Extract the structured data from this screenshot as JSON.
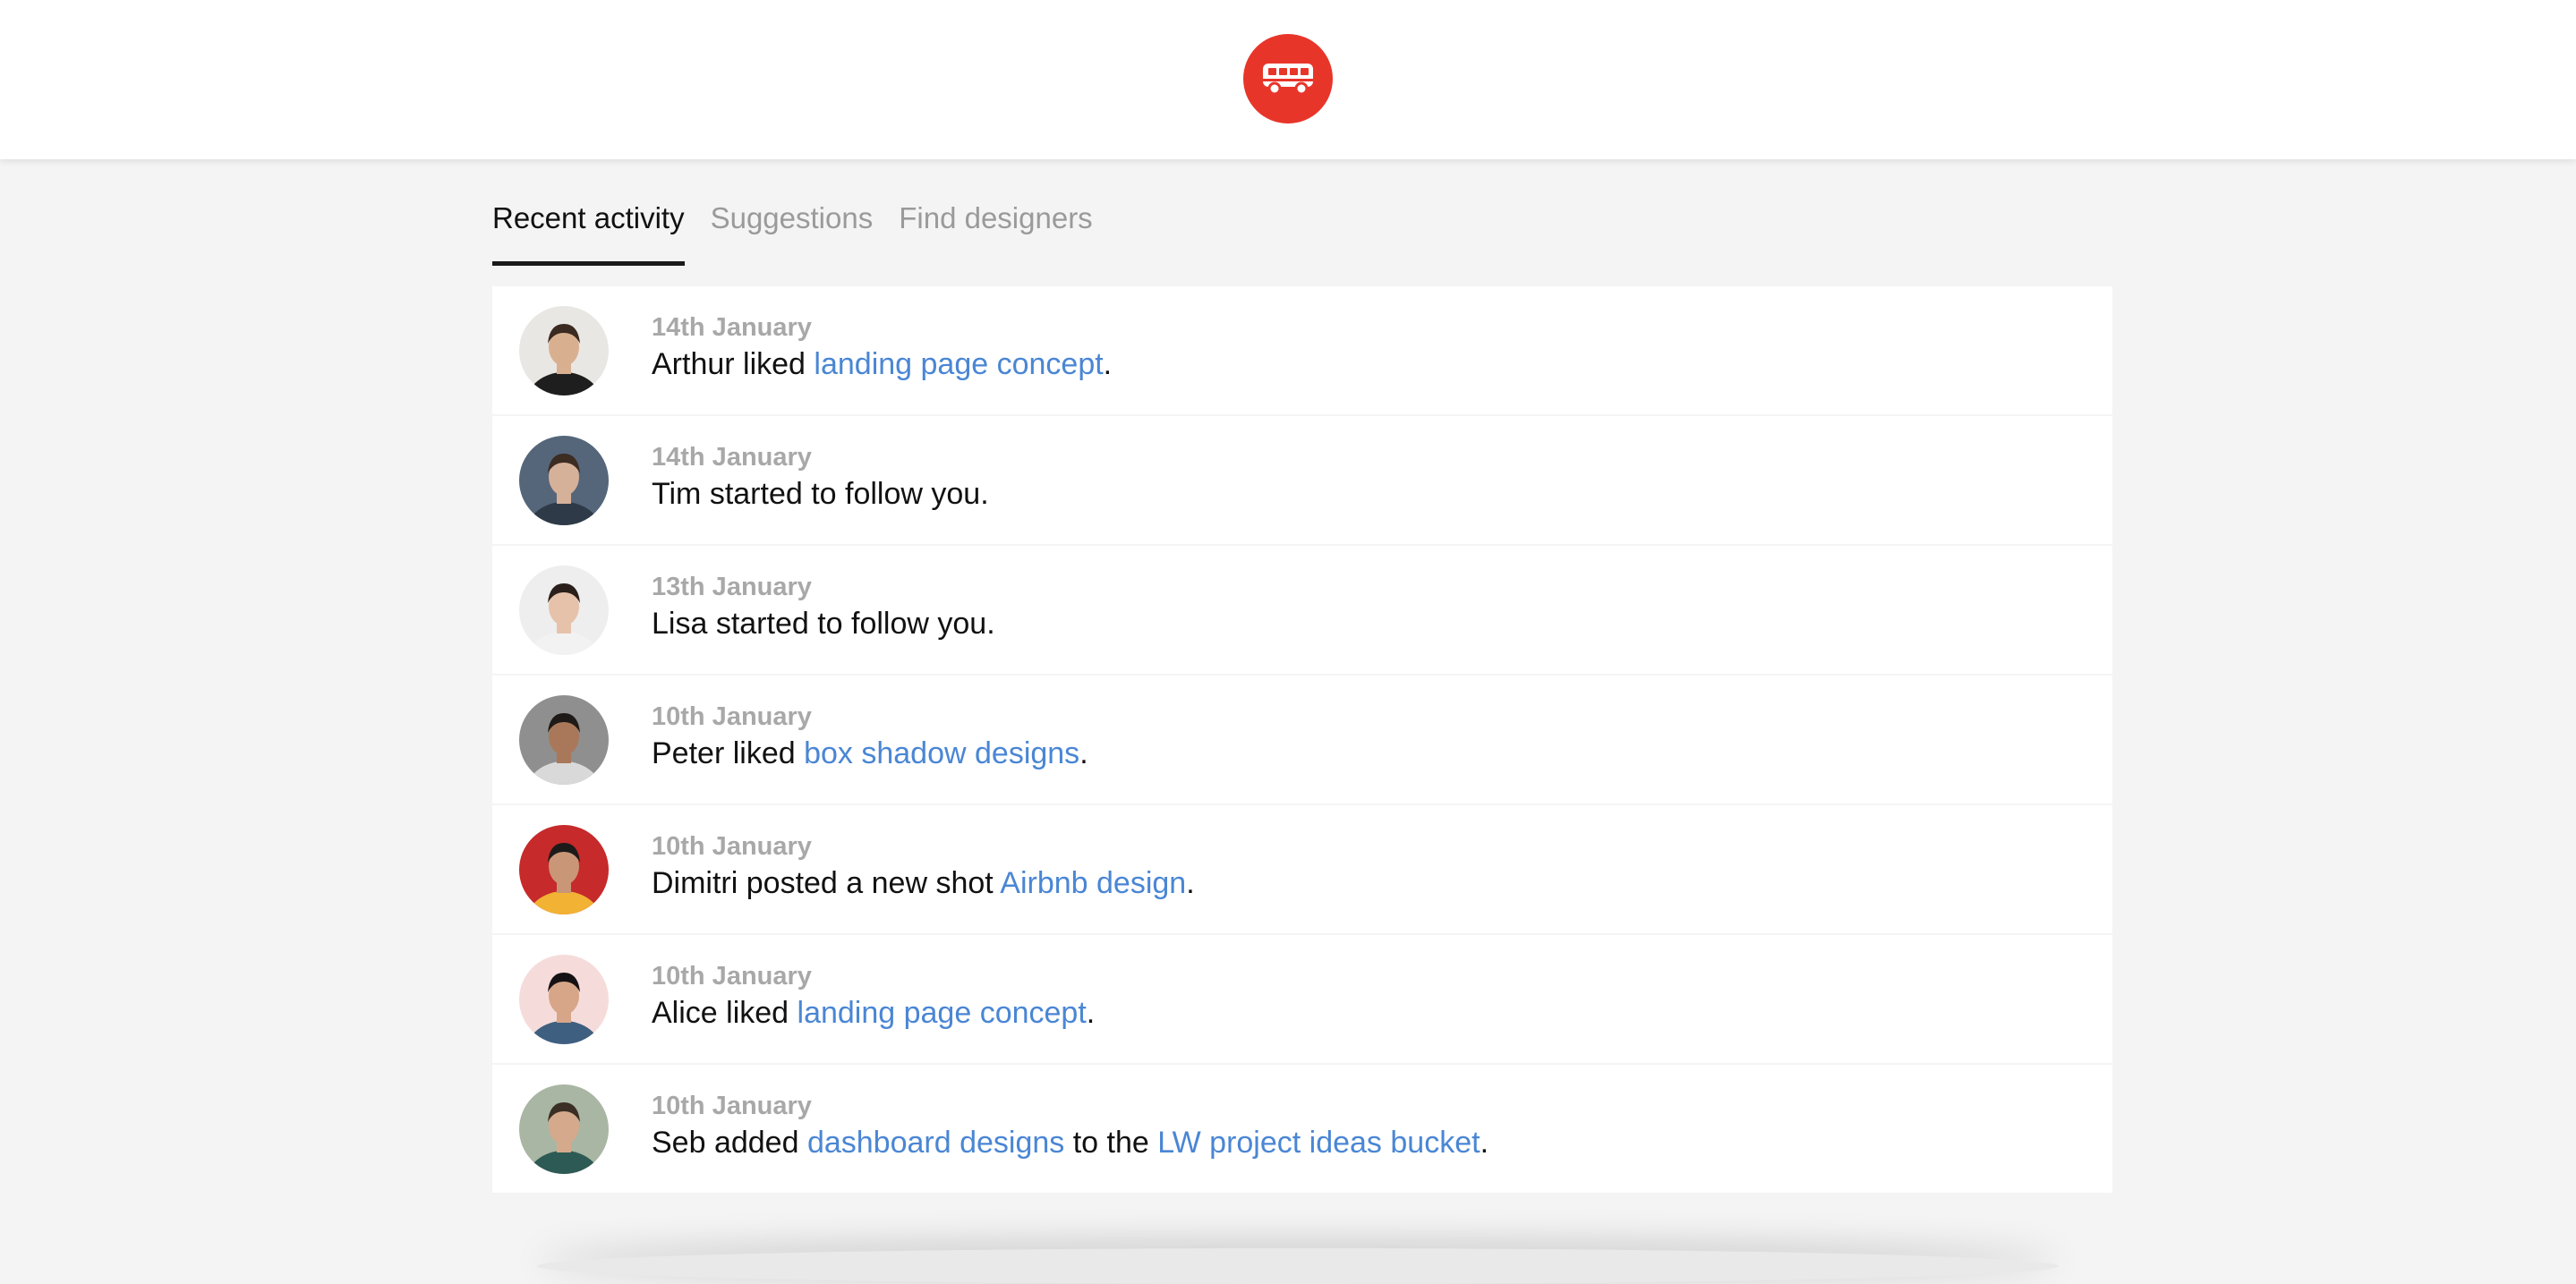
{
  "header": {
    "logo_icon": "bus-icon",
    "logo_color": "#e8352a"
  },
  "tabs": [
    {
      "label": "Recent activity",
      "active": true
    },
    {
      "label": "Suggestions",
      "active": false
    },
    {
      "label": "Find designers",
      "active": false
    }
  ],
  "activities": [
    {
      "date": "14th January",
      "parts": [
        {
          "text": "Arthur liked "
        },
        {
          "text": "landing page concept",
          "link": true
        },
        {
          "text": "."
        }
      ],
      "avatar": {
        "bg": "#e9e7e4",
        "skin": "#d9b08f",
        "hair": "#3a2a20",
        "shirt": "#1e1e1e"
      }
    },
    {
      "date": "14th January",
      "parts": [
        {
          "text": "Tim started to follow you."
        }
      ],
      "avatar": {
        "bg": "#55667a",
        "skin": "#d6b19a",
        "hair": "#3c2c22",
        "shirt": "#2f3a48"
      }
    },
    {
      "date": "13th January",
      "parts": [
        {
          "text": "Lisa started to follow you."
        }
      ],
      "avatar": {
        "bg": "#eeeeee",
        "skin": "#e6c2aa",
        "hair": "#2a1f1a",
        "shirt": "#f2f2f2"
      }
    },
    {
      "date": "10th January",
      "parts": [
        {
          "text": "Peter liked "
        },
        {
          "text": "box shadow designs",
          "link": true
        },
        {
          "text": "."
        }
      ],
      "avatar": {
        "bg": "#8f8f8f",
        "skin": "#a9785a",
        "hair": "#1f1a17",
        "shirt": "#d9d9d9"
      }
    },
    {
      "date": "10th January",
      "parts": [
        {
          "text": "Dimitri posted a new shot "
        },
        {
          "text": "Airbnb design",
          "link": true
        },
        {
          "text": "."
        }
      ],
      "avatar": {
        "bg": "#c62a2a",
        "skin": "#c99677",
        "hair": "#1d1a1a",
        "shirt": "#f2b233"
      }
    },
    {
      "date": "10th January",
      "parts": [
        {
          "text": "Alice liked "
        },
        {
          "text": "landing page concept",
          "link": true
        },
        {
          "text": "."
        }
      ],
      "avatar": {
        "bg": "#f5dcda",
        "skin": "#d7a587",
        "hair": "#161214",
        "shirt": "#3e5f80"
      }
    },
    {
      "date": "10th January",
      "parts": [
        {
          "text": "Seb added "
        },
        {
          "text": "dashboard designs",
          "link": true
        },
        {
          "text": " to the "
        },
        {
          "text": "LW project ideas bucket",
          "link": true
        },
        {
          "text": "."
        }
      ],
      "avatar": {
        "bg": "#a9b6a4",
        "skin": "#d5a98b",
        "hair": "#3b2e25",
        "shirt": "#2d5a54"
      }
    }
  ]
}
